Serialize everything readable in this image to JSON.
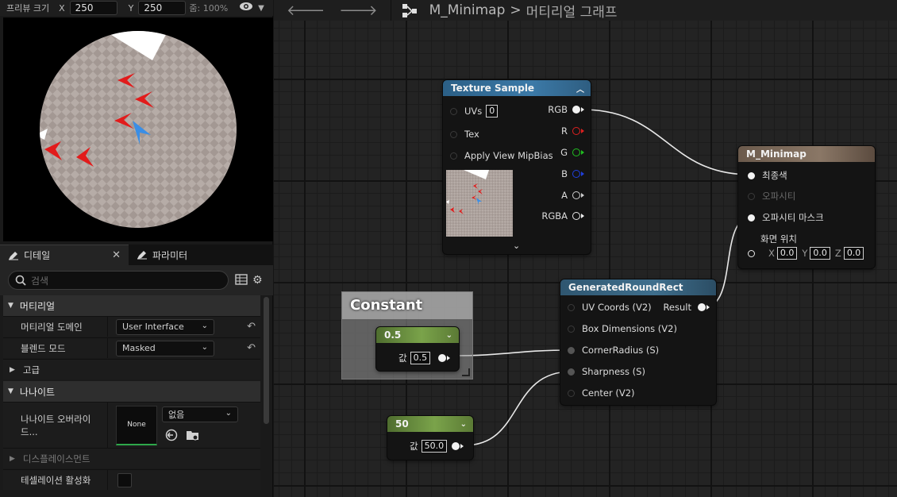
{
  "preview": {
    "label": "프리뷰 크기",
    "x_label": "X",
    "x_value": "250",
    "y_label": "Y",
    "y_value": "250",
    "zoom": "줌: 100%"
  },
  "details": {
    "tab_details": "디테일",
    "tab_params": "파라미터",
    "search_placeholder": "검색",
    "section_material": "머티리얼",
    "domain_label": "머티리얼 도메인",
    "domain_value": "User Interface",
    "blend_label": "블렌드 모드",
    "blend_value": "Masked",
    "section_advanced": "고급",
    "section_nanite": "나나이트",
    "nanite_override_label": "나나이트 오버라이드...",
    "nanite_swatch": "None",
    "nanite_value": "없음",
    "section_displacement": "디스플레이스먼트",
    "tessellation_label": "테셀레이션 활성화"
  },
  "graph": {
    "breadcrumb_asset": "M_Minimap",
    "breadcrumb_sep": ">",
    "breadcrumb_graph": "머티리얼 그래프",
    "texture_node": {
      "title": "Texture Sample",
      "in_uvs": "UVs",
      "uvs_value": "0",
      "in_tex": "Tex",
      "in_mipbias": "Apply View MipBias",
      "out_rgb": "RGB",
      "out_r": "R",
      "out_g": "G",
      "out_b": "B",
      "out_a": "A",
      "out_rgba": "RGBA"
    },
    "result_node": {
      "title": "M_Minimap",
      "in_final_color": "최종색",
      "in_opacity": "오파시티",
      "in_opacity_mask": "오파시티 마스크",
      "in_screen_position": "화면 위치",
      "x_label": "X",
      "x_value": "0.0",
      "y_label": "Y",
      "y_value": "0.0",
      "z_label": "Z",
      "z_value": "0.0"
    },
    "comment": {
      "title": "Constant"
    },
    "const1": {
      "title": "0.5",
      "value_label": "값",
      "value": "0.5"
    },
    "const2": {
      "title": "50",
      "value_label": "값",
      "value": "50.0"
    },
    "roundrect_node": {
      "title": "GeneratedRoundRect",
      "in_uv": "UV Coords (V2)",
      "in_box": "Box Dimensions (V2)",
      "in_corner": "CornerRadius (S)",
      "in_sharp": "Sharpness (S)",
      "in_center": "Center (V2)",
      "out_result": "Result"
    }
  },
  "colors": {
    "texture_header": "#2b5f86",
    "result_header": "#6b5a4c",
    "roundrect_header": "#2f5670",
    "constant_header": "#6f9a43",
    "pin_r": "#e02020",
    "pin_g": "#20c020",
    "pin_b": "#2040e0"
  }
}
